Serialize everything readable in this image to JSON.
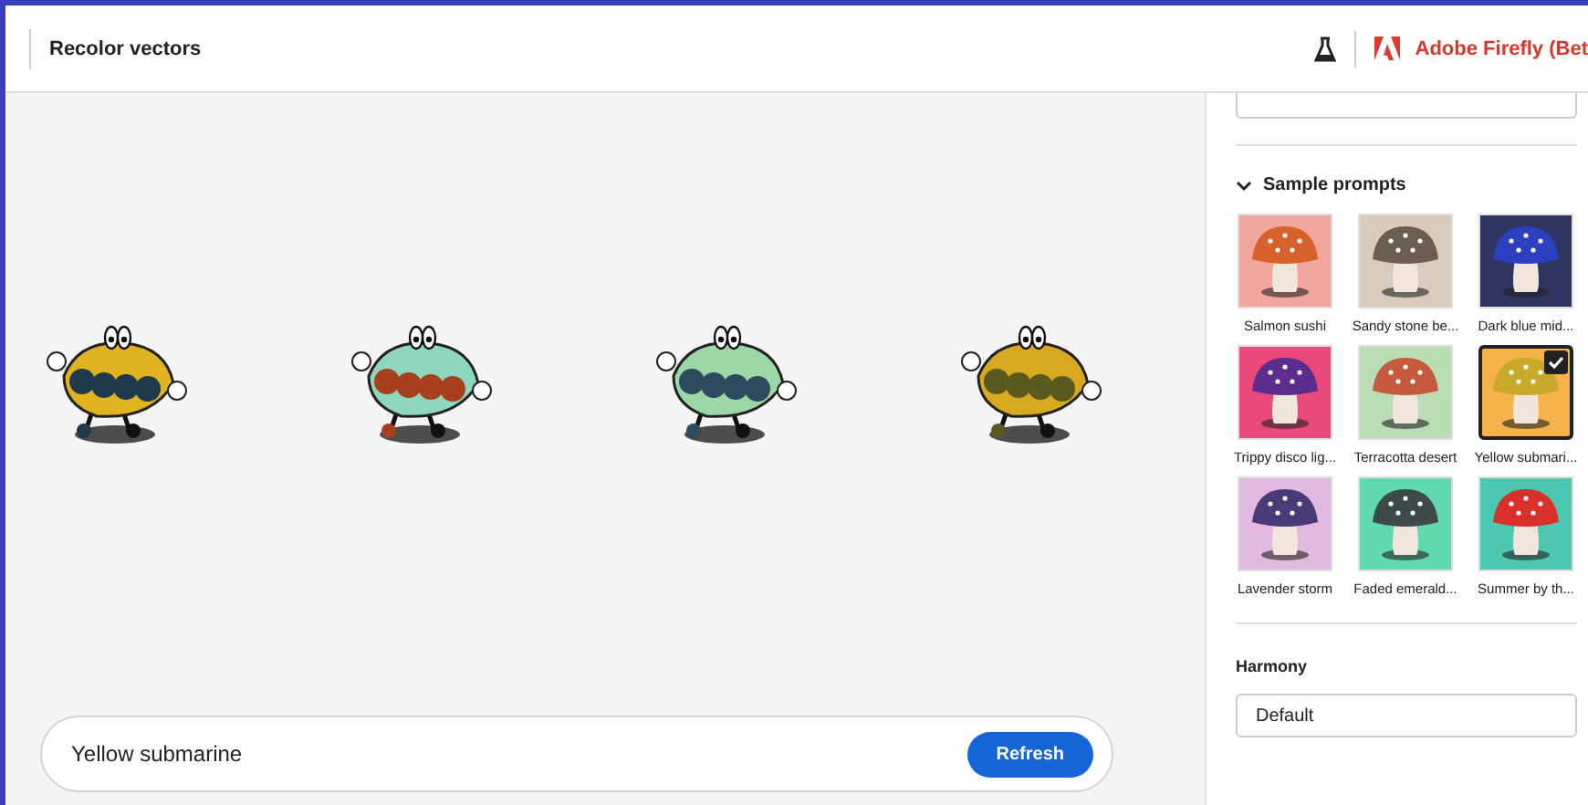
{
  "header": {
    "title": "Recolor vectors",
    "brand": "Adobe Firefly (Bet"
  },
  "prompt": {
    "value": "Yellow submarine",
    "button": "Refresh"
  },
  "panel": {
    "section": {
      "title": "Sample prompts",
      "expanded": true
    },
    "samples": [
      {
        "label": "Salmon sushi",
        "color": "#f2a59b",
        "selected": false
      },
      {
        "label": "Sandy stone be...",
        "color": "#d9cbbb",
        "selected": false
      },
      {
        "label": "Dark blue mid...",
        "color": "#2e3561",
        "selected": false
      },
      {
        "label": "Trippy disco lig...",
        "color": "#e8487a",
        "selected": false
      },
      {
        "label": "Terracotta desert",
        "color": "#b9dcb4",
        "selected": false
      },
      {
        "label": "Yellow submari...",
        "color": "#f5b24a",
        "selected": true
      },
      {
        "label": "Lavender storm",
        "color": "#e2b8df",
        "selected": false
      },
      {
        "label": "Faded emerald...",
        "color": "#5fd9ad",
        "selected": false
      },
      {
        "label": "Summer by th...",
        "color": "#4cc7b0",
        "selected": false
      }
    ],
    "harmony": {
      "label": "Harmony",
      "value": "Default"
    }
  }
}
